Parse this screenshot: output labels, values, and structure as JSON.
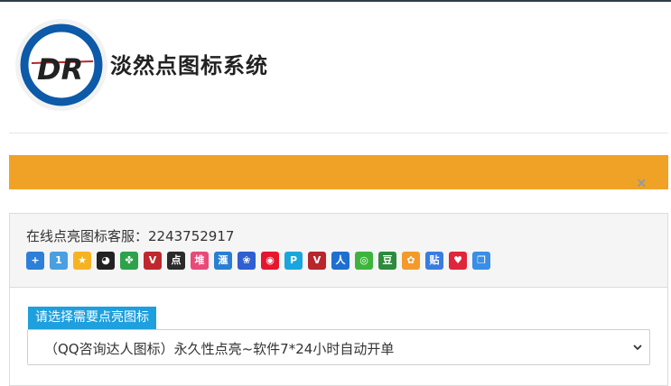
{
  "site": {
    "title": "淡然点图标系统",
    "logo_text": "DR"
  },
  "banner": {
    "close": "×",
    "color": "#f0a227"
  },
  "panel": {
    "customer_service": "在线点亮图标客服：2243752917",
    "icons": [
      {
        "name": "qq-member-icon",
        "glyph": "+",
        "color": "#2e7fd8"
      },
      {
        "name": "qq-level-icon",
        "glyph": "1",
        "color": "#4a9fe0"
      },
      {
        "name": "qq-vip-star-icon",
        "glyph": "★",
        "color": "#f6b321"
      },
      {
        "name": "qq-penguin-icon",
        "glyph": "◕",
        "color": "#222222"
      },
      {
        "name": "clover-icon",
        "glyph": "✤",
        "color": "#2da24a"
      },
      {
        "name": "red-v-icon",
        "glyph": "V",
        "color": "#c0282d"
      },
      {
        "name": "dian-icon",
        "glyph": "点",
        "color": "#2b2b2b"
      },
      {
        "name": "dui-icon",
        "glyph": "堆",
        "color": "#e84a7a"
      },
      {
        "name": "hui-icon",
        "glyph": "滙",
        "color": "#2b7fd1"
      },
      {
        "name": "baidu-paw-icon",
        "glyph": "❀",
        "color": "#2f5fd0"
      },
      {
        "name": "weibo-icon",
        "glyph": "◉",
        "color": "#e6162d"
      },
      {
        "name": "p-icon",
        "glyph": "P",
        "color": "#1aa6dd"
      },
      {
        "name": "red-v2-icon",
        "glyph": "V",
        "color": "#b8262c"
      },
      {
        "name": "ren-icon",
        "glyph": "人",
        "color": "#1f6fd0"
      },
      {
        "name": "wechat-icon",
        "glyph": "◎",
        "color": "#3db53d"
      },
      {
        "name": "douban-icon",
        "glyph": "豆",
        "color": "#2d8a3e"
      },
      {
        "name": "flower-icon",
        "glyph": "✿",
        "color": "#f39a2b"
      },
      {
        "name": "tieba-icon",
        "glyph": "贴",
        "color": "#3a7de0"
      },
      {
        "name": "heart-icon",
        "glyph": "♥",
        "color": "#e0263a"
      },
      {
        "name": "copy-icon",
        "glyph": "❐",
        "color": "#3a8ee6"
      }
    ],
    "select_label": "请选择需要点亮图标",
    "select_value": "（QQ咨询达人图标）永久性点亮~软件7*24小时自动开单"
  }
}
